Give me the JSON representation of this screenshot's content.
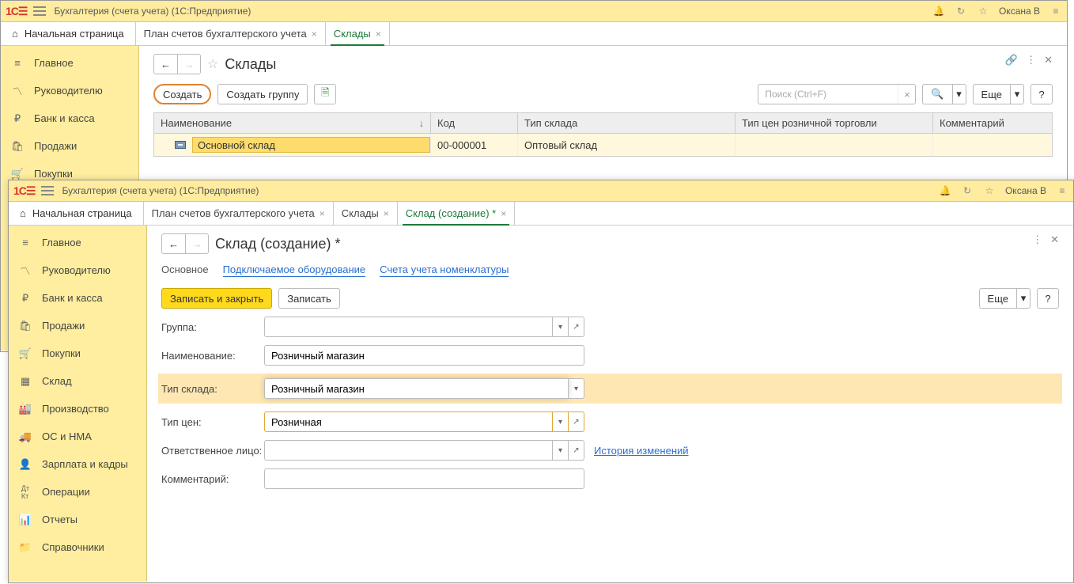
{
  "app": {
    "title": "Бухгалтерия (счета учета)  (1С:Предприятие)",
    "user": "Оксана В"
  },
  "tabs1": {
    "home": "Начальная страница",
    "t1": "План счетов бухгалтерского учета",
    "t2": "Склады"
  },
  "tabs2": {
    "home": "Начальная страница",
    "t1": "План счетов бухгалтерского учета",
    "t2": "Склады",
    "t3": "Склад (создание) *"
  },
  "sidebar": [
    "Главное",
    "Руководителю",
    "Банк и касса",
    "Продажи",
    "Покупки",
    "Склад",
    "Производство",
    "ОС и НМА",
    "Зарплата и кадры",
    "Операции",
    "Отчеты",
    "Справочники"
  ],
  "page1": {
    "title": "Склады",
    "create": "Создать",
    "createGroup": "Создать группу",
    "searchPlaceholder": "Поиск (Ctrl+F)",
    "more": "Еще",
    "cols": {
      "name": "Наименование",
      "code": "Код",
      "type": "Тип склада",
      "priceType": "Тип цен розничной торговли",
      "comment": "Комментарий"
    },
    "row": {
      "name": "Основной склад",
      "code": "00-000001",
      "type": "Оптовый склад"
    }
  },
  "page2": {
    "title": "Склад (создание) *",
    "subtabs": {
      "main": "Основное",
      "equip": "Подключаемое оборудование",
      "accounts": "Счета учета номенклатуры"
    },
    "saveClose": "Записать и закрыть",
    "save": "Записать",
    "more": "Еще",
    "labels": {
      "group": "Группа:",
      "name": "Наименование:",
      "type": "Тип склада:",
      "price": "Тип цен:",
      "resp": "Ответственное лицо:",
      "comment": "Комментарий:"
    },
    "values": {
      "name": "Розничный магазин",
      "type": "Розничный магазин",
      "price": "Розничная"
    },
    "history": "История изменений"
  }
}
